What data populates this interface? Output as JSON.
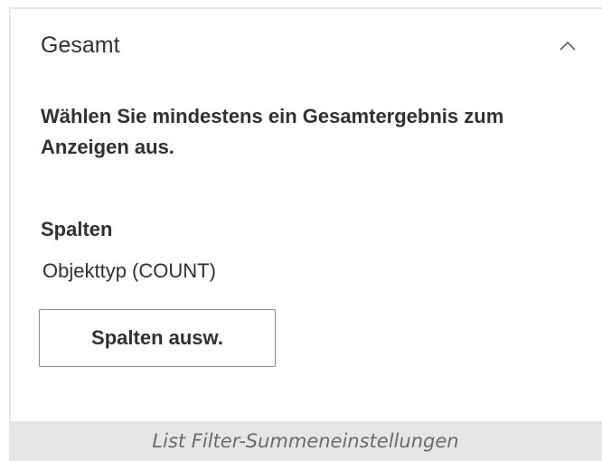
{
  "section": {
    "title": "Gesamt",
    "collapse_icon": "chevron-up-icon"
  },
  "description": "Wählen Sie mindestens ein Gesamtergebnis zum Anzeigen aus.",
  "columns": {
    "label": "Spalten",
    "value": "Objekttyp (COUNT)",
    "select_button_label": "Spalten ausw."
  },
  "caption": "List Filter-Summeneinstellungen",
  "colors": {
    "text": "#323130",
    "border": "#8a8886",
    "caption_bg": "#e6e6e6",
    "caption_text": "#6b6b6b"
  }
}
